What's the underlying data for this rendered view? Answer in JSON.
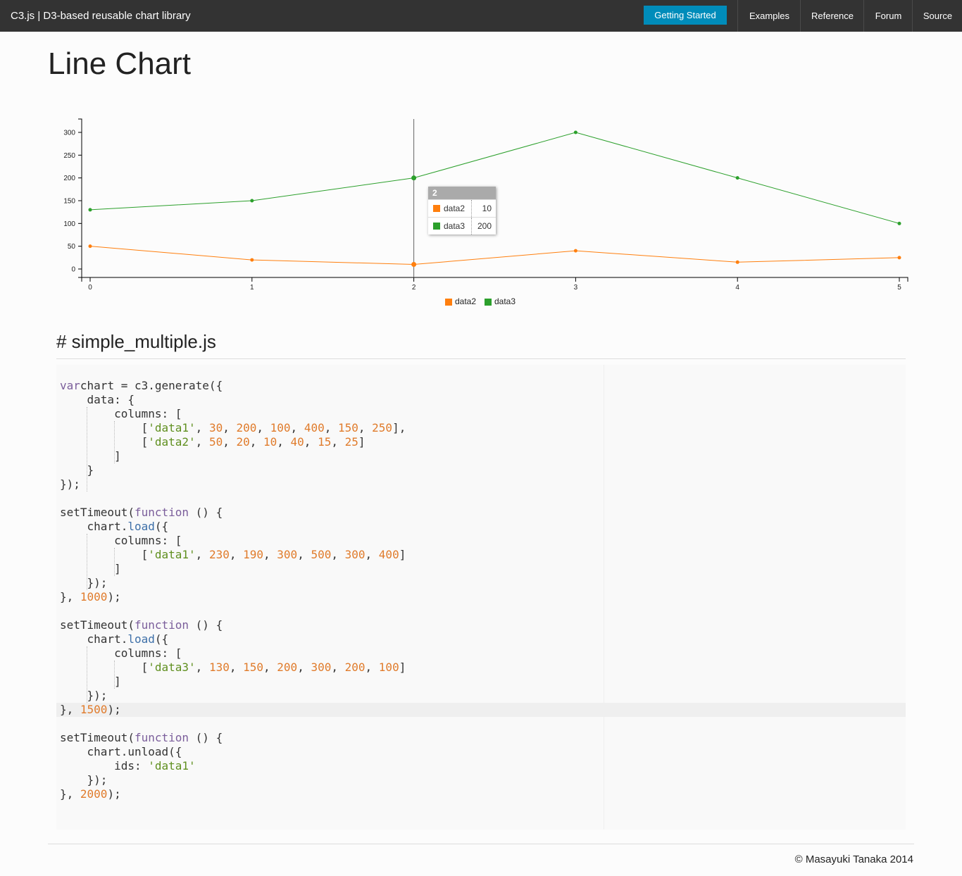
{
  "nav": {
    "brand": "C3.js | D3-based reusable chart library",
    "primary_button": "Getting Started",
    "items": [
      "Examples",
      "Reference",
      "Forum",
      "Source"
    ]
  },
  "page_title": "Line Chart",
  "colors": {
    "data2": "#ff7f0e",
    "data3": "#2ca02c",
    "accent": "#008cba",
    "navbar": "#333333"
  },
  "chart_data": {
    "type": "line",
    "x": [
      0,
      1,
      2,
      3,
      4,
      5
    ],
    "xlim": [
      0,
      5
    ],
    "ylim": [
      0,
      300
    ],
    "yticks": [
      0,
      50,
      100,
      150,
      200,
      250,
      300
    ],
    "series": [
      {
        "name": "data2",
        "color": "#ff7f0e",
        "values": [
          50,
          20,
          10,
          40,
          15,
          25
        ]
      },
      {
        "name": "data3",
        "color": "#2ca02c",
        "values": [
          130,
          150,
          200,
          300,
          200,
          100
        ]
      }
    ],
    "focus_index": 2,
    "legend": {
      "position": "bottom",
      "entries": [
        "data2",
        "data3"
      ]
    },
    "grid": false
  },
  "tooltip": {
    "title": "2",
    "rows": [
      {
        "name": "data2",
        "value": "10"
      },
      {
        "name": "data3",
        "value": "200"
      }
    ]
  },
  "code": {
    "filename": "# simple_multiple.js",
    "lines": [
      [
        [
          "kw",
          "var"
        ],
        [
          "",
          "chart = c3.generate({"
        ]
      ],
      [
        [
          "",
          "    data: {"
        ]
      ],
      [
        [
          "",
          "        columns: ["
        ]
      ],
      [
        [
          "",
          "            ["
        ],
        [
          "str",
          "'data1'"
        ],
        [
          "",
          ", "
        ],
        [
          "num",
          "30"
        ],
        [
          "",
          ", "
        ],
        [
          "num",
          "200"
        ],
        [
          "",
          ", "
        ],
        [
          "num",
          "100"
        ],
        [
          "",
          ", "
        ],
        [
          "num",
          "400"
        ],
        [
          "",
          ", "
        ],
        [
          "num",
          "150"
        ],
        [
          "",
          ", "
        ],
        [
          "num",
          "250"
        ],
        [
          "",
          "],"
        ]
      ],
      [
        [
          "",
          "            ["
        ],
        [
          "str",
          "'data2'"
        ],
        [
          "",
          ", "
        ],
        [
          "num",
          "50"
        ],
        [
          "",
          ", "
        ],
        [
          "num",
          "20"
        ],
        [
          "",
          ", "
        ],
        [
          "num",
          "10"
        ],
        [
          "",
          ", "
        ],
        [
          "num",
          "40"
        ],
        [
          "",
          ", "
        ],
        [
          "num",
          "15"
        ],
        [
          "",
          ", "
        ],
        [
          "num",
          "25"
        ],
        [
          "",
          "]"
        ]
      ],
      [
        [
          "",
          "        ]"
        ]
      ],
      [
        [
          "",
          "    }"
        ]
      ],
      [
        [
          "",
          "});"
        ]
      ],
      [
        [
          "",
          ""
        ]
      ],
      [
        [
          "",
          "setTimeout("
        ],
        [
          "kw",
          "function"
        ],
        [
          "",
          " () {"
        ]
      ],
      [
        [
          "",
          "    chart."
        ],
        [
          "fn",
          "load"
        ],
        [
          "",
          "({"
        ]
      ],
      [
        [
          "",
          "        columns: ["
        ]
      ],
      [
        [
          "",
          "            ["
        ],
        [
          "str",
          "'data1'"
        ],
        [
          "",
          ", "
        ],
        [
          "num",
          "230"
        ],
        [
          "",
          ", "
        ],
        [
          "num",
          "190"
        ],
        [
          "",
          ", "
        ],
        [
          "num",
          "300"
        ],
        [
          "",
          ", "
        ],
        [
          "num",
          "500"
        ],
        [
          "",
          ", "
        ],
        [
          "num",
          "300"
        ],
        [
          "",
          ", "
        ],
        [
          "num",
          "400"
        ],
        [
          "",
          "]"
        ]
      ],
      [
        [
          "",
          "        ]"
        ]
      ],
      [
        [
          "",
          "    });"
        ]
      ],
      [
        [
          "",
          "}, "
        ],
        [
          "num",
          "1000"
        ],
        [
          "",
          ");"
        ]
      ],
      [
        [
          "",
          ""
        ]
      ],
      [
        [
          "",
          "setTimeout("
        ],
        [
          "kw",
          "function"
        ],
        [
          "",
          " () {"
        ]
      ],
      [
        [
          "",
          "    chart."
        ],
        [
          "fn",
          "load"
        ],
        [
          "",
          "({"
        ]
      ],
      [
        [
          "",
          "        columns: ["
        ]
      ],
      [
        [
          "",
          "            ["
        ],
        [
          "str",
          "'data3'"
        ],
        [
          "",
          ", "
        ],
        [
          "num",
          "130"
        ],
        [
          "",
          ", "
        ],
        [
          "num",
          "150"
        ],
        [
          "",
          ", "
        ],
        [
          "num",
          "200"
        ],
        [
          "",
          ", "
        ],
        [
          "num",
          "300"
        ],
        [
          "",
          ", "
        ],
        [
          "num",
          "200"
        ],
        [
          "",
          ", "
        ],
        [
          "num",
          "100"
        ],
        [
          "",
          "]"
        ]
      ],
      [
        [
          "",
          "        ]"
        ]
      ],
      [
        [
          "",
          "    });"
        ]
      ],
      [
        [
          "",
          "}, "
        ],
        [
          "num",
          "1500"
        ],
        [
          "",
          ");"
        ]
      ],
      [
        [
          "",
          ""
        ]
      ],
      [
        [
          "",
          "setTimeout("
        ],
        [
          "kw",
          "function"
        ],
        [
          "",
          " () {"
        ]
      ],
      [
        [
          "",
          "    chart.unload({"
        ]
      ],
      [
        [
          "",
          "        ids: "
        ],
        [
          "str",
          "'data1'"
        ]
      ],
      [
        [
          "",
          "    });"
        ]
      ],
      [
        [
          "",
          "}, "
        ],
        [
          "num",
          "2000"
        ],
        [
          "",
          ");"
        ]
      ]
    ]
  },
  "footer": "© Masayuki Tanaka 2014"
}
